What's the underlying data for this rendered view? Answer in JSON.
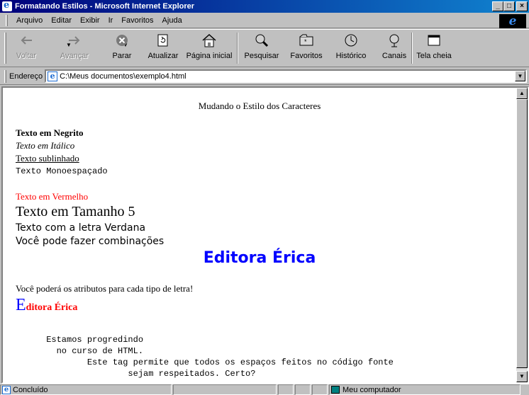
{
  "window": {
    "title": "Formatando Estilos - Microsoft Internet Explorer"
  },
  "menu": [
    "Arquivo",
    "Editar",
    "Exibir",
    "Ir",
    "Favoritos",
    "Ajuda"
  ],
  "toolbar": {
    "back": "Voltar",
    "forward": "Avançar",
    "stop": "Parar",
    "refresh": "Atualizar",
    "home": "Página inicial",
    "search": "Pesquisar",
    "favorites": "Favoritos",
    "history": "Histórico",
    "channels": "Canais",
    "fullscreen": "Tela cheia"
  },
  "address": {
    "label": "Endereço",
    "value": "C:\\Meus documentos\\exemplo4.html"
  },
  "page": {
    "title": "Mudando o Estilo dos Caracteres",
    "bold": "Texto em Negrito",
    "italic": "Texto em Itálico",
    "underline": "Texto sublinhado",
    "mono": "Texto Monoespaçado",
    "red": "Texto em Vermelho",
    "size5": "Texto em Tamanho 5",
    "verdana": "Texto com a letra Verdana",
    "combos": "Você pode fazer combinações",
    "editora_big": "Editora Érica",
    "attrs": "Você poderá os atributos para cada tipo de letra!",
    "editora_e": "E",
    "editora_rest": "ditora Érica",
    "pre_lines": [
      "      Estamos progredindo",
      "        no curso de HTML.",
      "              Este tag permite que todos os espaços feitos no código fonte",
      "                      sejam respeitados. Certo?"
    ]
  },
  "status": {
    "text": "Concluído",
    "zone": "Meu computador"
  }
}
